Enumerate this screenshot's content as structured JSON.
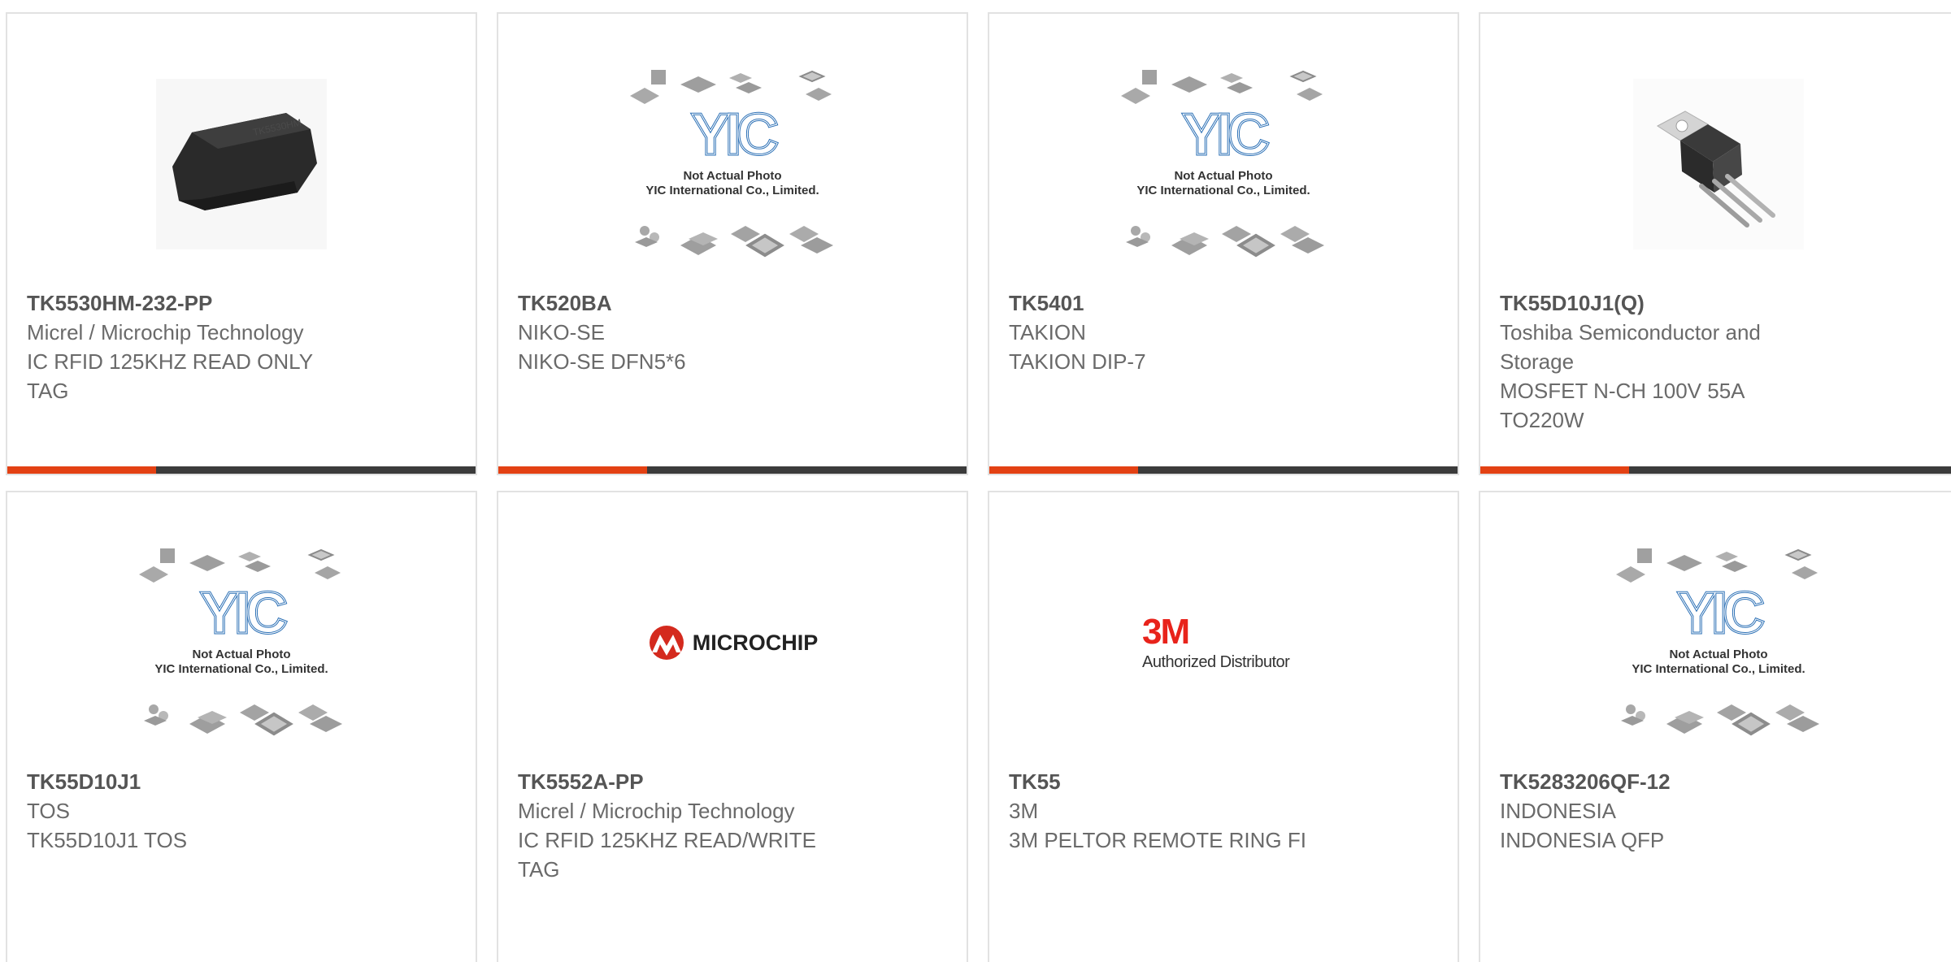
{
  "colors": {
    "accent": "#e34113",
    "bar_dark": "#3b3b3b",
    "border": "#e2e2e2",
    "yic_blue": "#2a6fb5"
  },
  "placeholder": {
    "line1": "Not Actual Photo",
    "line2": "YIC International Co., Limited.",
    "logo_text": "YIC"
  },
  "microchip_logo_text": "MICROCHIP",
  "threem_logo": {
    "mark": "3M",
    "caption": "Authorized Distributor"
  },
  "products": [
    {
      "part": "TK5530HM-232-PP",
      "manufacturer": "Micrel / Microchip Technology",
      "description": "IC RFID 125KHZ READ ONLY TAG",
      "image": "rfid-tag-photo"
    },
    {
      "part": "TK520BA",
      "manufacturer": "NIKO-SE",
      "description": "NIKO-SE DFN5*6",
      "image": "placeholder"
    },
    {
      "part": "TK5401",
      "manufacturer": "TAKION",
      "description": "TAKION DIP-7",
      "image": "placeholder"
    },
    {
      "part": "TK55D10J1(Q)",
      "manufacturer": "Toshiba Semiconductor and Storage",
      "description": "MOSFET N-CH 100V 55A TO220W",
      "image": "to220-photo"
    },
    {
      "part": "TK55D10J1",
      "manufacturer": "TOS",
      "description": "TK55D10J1 TOS",
      "image": "placeholder"
    },
    {
      "part": "TK5552A-PP",
      "manufacturer": "Micrel / Microchip Technology",
      "description": "IC RFID 125KHZ READ/WRITE TAG",
      "image": "microchip-logo"
    },
    {
      "part": "TK55",
      "manufacturer": "3M",
      "description": "3M PELTOR REMOTE RING FI",
      "image": "3m-logo"
    },
    {
      "part": "TK5283206QF-12",
      "manufacturer": "INDONESIA",
      "description": "INDONESIA QFP",
      "image": "placeholder"
    }
  ]
}
